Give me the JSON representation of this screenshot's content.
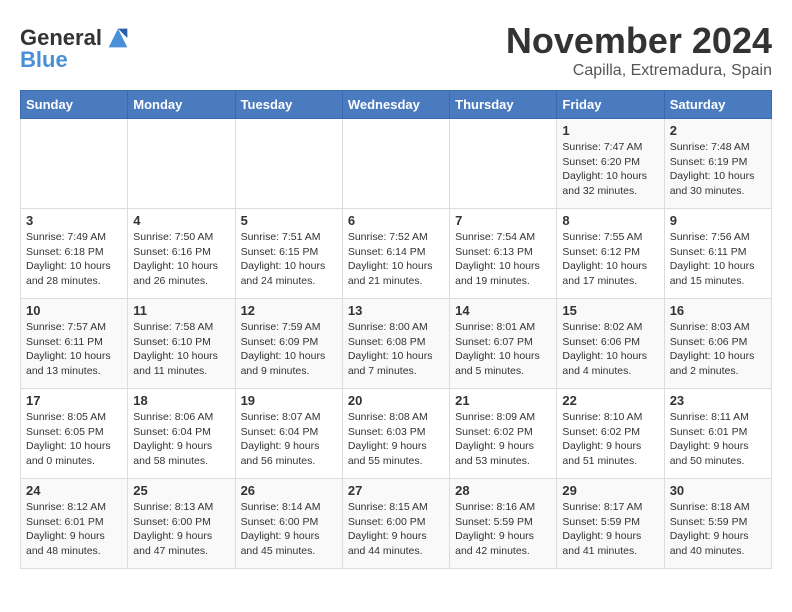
{
  "logo": {
    "line1": "General",
    "line2": "Blue"
  },
  "title": "November 2024",
  "location": "Capilla, Extremadura, Spain",
  "weekdays": [
    "Sunday",
    "Monday",
    "Tuesday",
    "Wednesday",
    "Thursday",
    "Friday",
    "Saturday"
  ],
  "rows": [
    [
      {
        "day": "",
        "text": ""
      },
      {
        "day": "",
        "text": ""
      },
      {
        "day": "",
        "text": ""
      },
      {
        "day": "",
        "text": ""
      },
      {
        "day": "",
        "text": ""
      },
      {
        "day": "1",
        "text": "Sunrise: 7:47 AM\nSunset: 6:20 PM\nDaylight: 10 hours and 32 minutes."
      },
      {
        "day": "2",
        "text": "Sunrise: 7:48 AM\nSunset: 6:19 PM\nDaylight: 10 hours and 30 minutes."
      }
    ],
    [
      {
        "day": "3",
        "text": "Sunrise: 7:49 AM\nSunset: 6:18 PM\nDaylight: 10 hours and 28 minutes."
      },
      {
        "day": "4",
        "text": "Sunrise: 7:50 AM\nSunset: 6:16 PM\nDaylight: 10 hours and 26 minutes."
      },
      {
        "day": "5",
        "text": "Sunrise: 7:51 AM\nSunset: 6:15 PM\nDaylight: 10 hours and 24 minutes."
      },
      {
        "day": "6",
        "text": "Sunrise: 7:52 AM\nSunset: 6:14 PM\nDaylight: 10 hours and 21 minutes."
      },
      {
        "day": "7",
        "text": "Sunrise: 7:54 AM\nSunset: 6:13 PM\nDaylight: 10 hours and 19 minutes."
      },
      {
        "day": "8",
        "text": "Sunrise: 7:55 AM\nSunset: 6:12 PM\nDaylight: 10 hours and 17 minutes."
      },
      {
        "day": "9",
        "text": "Sunrise: 7:56 AM\nSunset: 6:11 PM\nDaylight: 10 hours and 15 minutes."
      }
    ],
    [
      {
        "day": "10",
        "text": "Sunrise: 7:57 AM\nSunset: 6:11 PM\nDaylight: 10 hours and 13 minutes."
      },
      {
        "day": "11",
        "text": "Sunrise: 7:58 AM\nSunset: 6:10 PM\nDaylight: 10 hours and 11 minutes."
      },
      {
        "day": "12",
        "text": "Sunrise: 7:59 AM\nSunset: 6:09 PM\nDaylight: 10 hours and 9 minutes."
      },
      {
        "day": "13",
        "text": "Sunrise: 8:00 AM\nSunset: 6:08 PM\nDaylight: 10 hours and 7 minutes."
      },
      {
        "day": "14",
        "text": "Sunrise: 8:01 AM\nSunset: 6:07 PM\nDaylight: 10 hours and 5 minutes."
      },
      {
        "day": "15",
        "text": "Sunrise: 8:02 AM\nSunset: 6:06 PM\nDaylight: 10 hours and 4 minutes."
      },
      {
        "day": "16",
        "text": "Sunrise: 8:03 AM\nSunset: 6:06 PM\nDaylight: 10 hours and 2 minutes."
      }
    ],
    [
      {
        "day": "17",
        "text": "Sunrise: 8:05 AM\nSunset: 6:05 PM\nDaylight: 10 hours and 0 minutes."
      },
      {
        "day": "18",
        "text": "Sunrise: 8:06 AM\nSunset: 6:04 PM\nDaylight: 9 hours and 58 minutes."
      },
      {
        "day": "19",
        "text": "Sunrise: 8:07 AM\nSunset: 6:04 PM\nDaylight: 9 hours and 56 minutes."
      },
      {
        "day": "20",
        "text": "Sunrise: 8:08 AM\nSunset: 6:03 PM\nDaylight: 9 hours and 55 minutes."
      },
      {
        "day": "21",
        "text": "Sunrise: 8:09 AM\nSunset: 6:02 PM\nDaylight: 9 hours and 53 minutes."
      },
      {
        "day": "22",
        "text": "Sunrise: 8:10 AM\nSunset: 6:02 PM\nDaylight: 9 hours and 51 minutes."
      },
      {
        "day": "23",
        "text": "Sunrise: 8:11 AM\nSunset: 6:01 PM\nDaylight: 9 hours and 50 minutes."
      }
    ],
    [
      {
        "day": "24",
        "text": "Sunrise: 8:12 AM\nSunset: 6:01 PM\nDaylight: 9 hours and 48 minutes."
      },
      {
        "day": "25",
        "text": "Sunrise: 8:13 AM\nSunset: 6:00 PM\nDaylight: 9 hours and 47 minutes."
      },
      {
        "day": "26",
        "text": "Sunrise: 8:14 AM\nSunset: 6:00 PM\nDaylight: 9 hours and 45 minutes."
      },
      {
        "day": "27",
        "text": "Sunrise: 8:15 AM\nSunset: 6:00 PM\nDaylight: 9 hours and 44 minutes."
      },
      {
        "day": "28",
        "text": "Sunrise: 8:16 AM\nSunset: 5:59 PM\nDaylight: 9 hours and 42 minutes."
      },
      {
        "day": "29",
        "text": "Sunrise: 8:17 AM\nSunset: 5:59 PM\nDaylight: 9 hours and 41 minutes."
      },
      {
        "day": "30",
        "text": "Sunrise: 8:18 AM\nSunset: 5:59 PM\nDaylight: 9 hours and 40 minutes."
      }
    ]
  ]
}
